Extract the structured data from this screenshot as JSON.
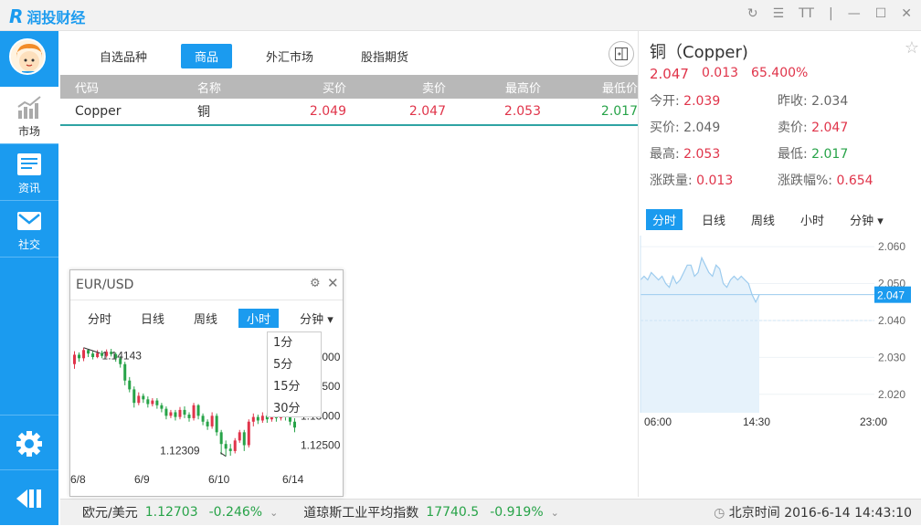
{
  "app": {
    "name_prefix": "润投",
    "name_suffix": "财经"
  },
  "window_controls": [
    "↻",
    "☰",
    "TT",
    "|",
    "—",
    "☐",
    "✕"
  ],
  "sidebar": {
    "items": [
      {
        "label": "市场",
        "icon": "market-chart-icon",
        "active": true
      },
      {
        "label": "资讯",
        "icon": "news-icon",
        "active": false
      },
      {
        "label": "社交",
        "icon": "mail-icon",
        "active": false
      }
    ],
    "bottom": [
      {
        "icon": "gear-icon"
      },
      {
        "icon": "exit-arrow-icon"
      }
    ]
  },
  "main": {
    "tabs": [
      {
        "label": "自选品种",
        "active": false
      },
      {
        "label": "商品",
        "active": true
      },
      {
        "label": "外汇市场",
        "active": false
      },
      {
        "label": "股指期货",
        "active": false
      }
    ],
    "table": {
      "headers": [
        "代码",
        "名称",
        "买价",
        "卖价",
        "最高价",
        "最低价"
      ],
      "rows": [
        {
          "code": "Copper",
          "name": "铜",
          "bid": "2.049",
          "ask": "2.047",
          "high": "2.053",
          "low": "2.017"
        }
      ]
    }
  },
  "detail": {
    "title": "铜（Copper)",
    "price": "2.047",
    "change": "0.013",
    "change_pct": "65.400%",
    "fields": [
      {
        "label": "今开: ",
        "value": "2.039",
        "color": "red"
      },
      {
        "label": "昨收: ",
        "value": "2.034",
        "color": "plain"
      },
      {
        "label": "买价: ",
        "value": "2.049",
        "color": "plain"
      },
      {
        "label": "卖价: ",
        "value": "2.047",
        "color": "red"
      },
      {
        "label": "最高: ",
        "value": "2.053",
        "color": "red"
      },
      {
        "label": "最低: ",
        "value": "2.017",
        "color": "green"
      },
      {
        "label": "涨跌量: ",
        "value": "0.013",
        "color": "red"
      },
      {
        "label": "涨跌幅%: ",
        "value": "0.654",
        "color": "red"
      }
    ],
    "tabs": [
      {
        "label": "分时",
        "active": true
      },
      {
        "label": "日线",
        "active": false
      },
      {
        "label": "周线",
        "active": false
      },
      {
        "label": "小时",
        "active": false
      },
      {
        "label": "分钟 ▾",
        "active": false
      }
    ]
  },
  "chart_data": [
    {
      "type": "area",
      "title": "",
      "x_ticks": [
        "06:00",
        "14:30",
        "23:00"
      ],
      "y_ticks": [
        "2.060",
        "2.050",
        "2.040",
        "2.030",
        "2.020"
      ],
      "ylim": [
        2.015,
        2.063
      ],
      "current_label": "2.047",
      "reference_line": 2.04,
      "values": [
        2.051,
        2.052,
        2.051,
        2.053,
        2.052,
        2.051,
        2.052,
        2.05,
        2.049,
        2.052,
        2.05,
        2.051,
        2.053,
        2.055,
        2.055,
        2.052,
        2.053,
        2.057,
        2.055,
        2.053,
        2.052,
        2.055,
        2.054,
        2.05,
        2.049,
        2.051,
        2.052,
        2.051,
        2.052,
        2.051,
        2.05,
        2.047,
        2.045,
        2.047
      ],
      "grid": true
    },
    {
      "type": "candlestick",
      "title": "EUR/USD",
      "x_ticks": [
        "6/8",
        "6/9",
        "6/10",
        "6/14"
      ],
      "y_ticks": [
        "1.14000",
        "1.13500",
        "1.13000",
        "1.12500"
      ],
      "annotations": [
        "1.14143",
        "1.12309"
      ],
      "ylim": [
        1.1215,
        1.1442
      ],
      "candles": [
        [
          1.1388,
          1.1404,
          1.138,
          1.141
        ],
        [
          1.1404,
          1.1398,
          1.1392,
          1.1408
        ],
        [
          1.1398,
          1.1412,
          1.1393,
          1.1416
        ],
        [
          1.1412,
          1.1406,
          1.14,
          1.1414
        ],
        [
          1.1406,
          1.14,
          1.1396,
          1.141
        ],
        [
          1.14,
          1.1407,
          1.1398,
          1.1412
        ],
        [
          1.1407,
          1.1402,
          1.1398,
          1.1411
        ],
        [
          1.1402,
          1.1409,
          1.1399,
          1.1413
        ],
        [
          1.1409,
          1.1405,
          1.1401,
          1.1414
        ],
        [
          1.1405,
          1.1398,
          1.1392,
          1.1408
        ],
        [
          1.1398,
          1.1388,
          1.1382,
          1.1401
        ],
        [
          1.1388,
          1.136,
          1.1352,
          1.1392
        ],
        [
          1.136,
          1.1345,
          1.134,
          1.1366
        ],
        [
          1.1345,
          1.1322,
          1.1314,
          1.135
        ],
        [
          1.1322,
          1.1334,
          1.1318,
          1.134
        ],
        [
          1.1334,
          1.1328,
          1.1322,
          1.1338
        ],
        [
          1.1328,
          1.132,
          1.1314,
          1.1333
        ],
        [
          1.132,
          1.1326,
          1.1316,
          1.133
        ],
        [
          1.1326,
          1.1318,
          1.1312,
          1.133
        ],
        [
          1.1318,
          1.1312,
          1.1306,
          1.1322
        ],
        [
          1.1312,
          1.13,
          1.1294,
          1.1316
        ],
        [
          1.13,
          1.1306,
          1.1296,
          1.131
        ],
        [
          1.1306,
          1.1298,
          1.1292,
          1.131
        ],
        [
          1.1298,
          1.131,
          1.1294,
          1.1315
        ],
        [
          1.131,
          1.1302,
          1.1296,
          1.1316
        ],
        [
          1.1302,
          1.1296,
          1.129,
          1.1306
        ],
        [
          1.1296,
          1.1318,
          1.1292,
          1.1322
        ],
        [
          1.1318,
          1.13,
          1.1294,
          1.132
        ],
        [
          1.13,
          1.129,
          1.1284,
          1.1304
        ],
        [
          1.129,
          1.1282,
          1.1276,
          1.1294
        ],
        [
          1.1282,
          1.13,
          1.1278,
          1.1306
        ],
        [
          1.13,
          1.1272,
          1.1266,
          1.1304
        ],
        [
          1.1272,
          1.1252,
          1.1234,
          1.1276
        ],
        [
          1.1252,
          1.1244,
          1.1231,
          1.1258
        ],
        [
          1.1244,
          1.124,
          1.1232,
          1.1252
        ],
        [
          1.124,
          1.1258,
          1.1236,
          1.1262
        ],
        [
          1.1258,
          1.1272,
          1.1254,
          1.1276
        ],
        [
          1.1272,
          1.125,
          1.124,
          1.1276
        ],
        [
          1.125,
          1.129,
          1.1246,
          1.1294
        ],
        [
          1.129,
          1.1298,
          1.1282,
          1.1304
        ],
        [
          1.1298,
          1.1292,
          1.1286,
          1.1302
        ],
        [
          1.1292,
          1.13,
          1.1288,
          1.1306
        ],
        [
          1.13,
          1.1294,
          1.1288,
          1.1304
        ],
        [
          1.1294,
          1.1302,
          1.129,
          1.1308
        ],
        [
          1.1302,
          1.1296,
          1.129,
          1.1306
        ],
        [
          1.1296,
          1.1306,
          1.1292,
          1.1312
        ],
        [
          1.1306,
          1.1298,
          1.1292,
          1.131
        ],
        [
          1.1298,
          1.129,
          1.1284,
          1.1302
        ],
        [
          1.129,
          1.128,
          1.1272,
          1.1296
        ]
      ]
    }
  ],
  "float_window": {
    "title": "EUR/USD",
    "tabs": [
      {
        "label": "分时",
        "active": false
      },
      {
        "label": "日线",
        "active": false
      },
      {
        "label": "周线",
        "active": false
      },
      {
        "label": "小时",
        "active": true
      },
      {
        "label": "分钟 ▾",
        "active": false
      }
    ],
    "dropdown": [
      "1分",
      "5分",
      "15分",
      "30分"
    ]
  },
  "bottom": {
    "items": [
      {
        "name": "欧元/美元",
        "price": "1.12703",
        "pct": "-0.246%"
      },
      {
        "name": "道琼斯工业平均指数",
        "price": "17740.5",
        "pct": "-0.919%"
      }
    ],
    "time": "北京时间 2016-6-14 14:43:10"
  },
  "colors": {
    "accent": "#1b9bef",
    "up": "#e0344a",
    "down": "#27a348"
  }
}
